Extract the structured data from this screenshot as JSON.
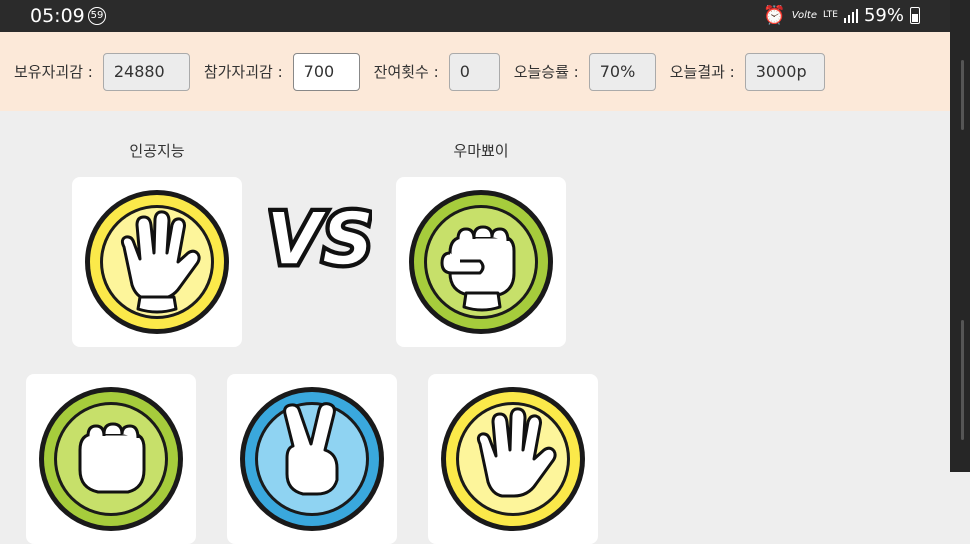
{
  "status_bar": {
    "time": "05:09",
    "notification_count": "59",
    "network": "Volte",
    "lte": "LTE",
    "battery": "59%"
  },
  "info_bar": {
    "holdings_label": "보유자괴감 :",
    "holdings_value": "24880",
    "bet_label": "참가자괴감 :",
    "bet_value": "700",
    "remaining_label": "잔여횟수 :",
    "remaining_value": "0",
    "winrate_label": "오늘승률 :",
    "winrate_value": "70%",
    "result_label": "오늘결과 :",
    "result_value": "3000p"
  },
  "game": {
    "opponent_name": "인공지능",
    "player_name": "우마뾰이",
    "vs_text": "VS",
    "opponent_choice": "paper-icon",
    "player_choice": "rock-icon",
    "choices": [
      "rock-icon",
      "scissors-icon",
      "paper-icon"
    ]
  },
  "colors": {
    "paper_yellow": "#fbe94a",
    "rock_green": "#a6cc3c",
    "scissors_blue": "#6ec6ea",
    "info_bar_bg": "#fce9d9"
  }
}
